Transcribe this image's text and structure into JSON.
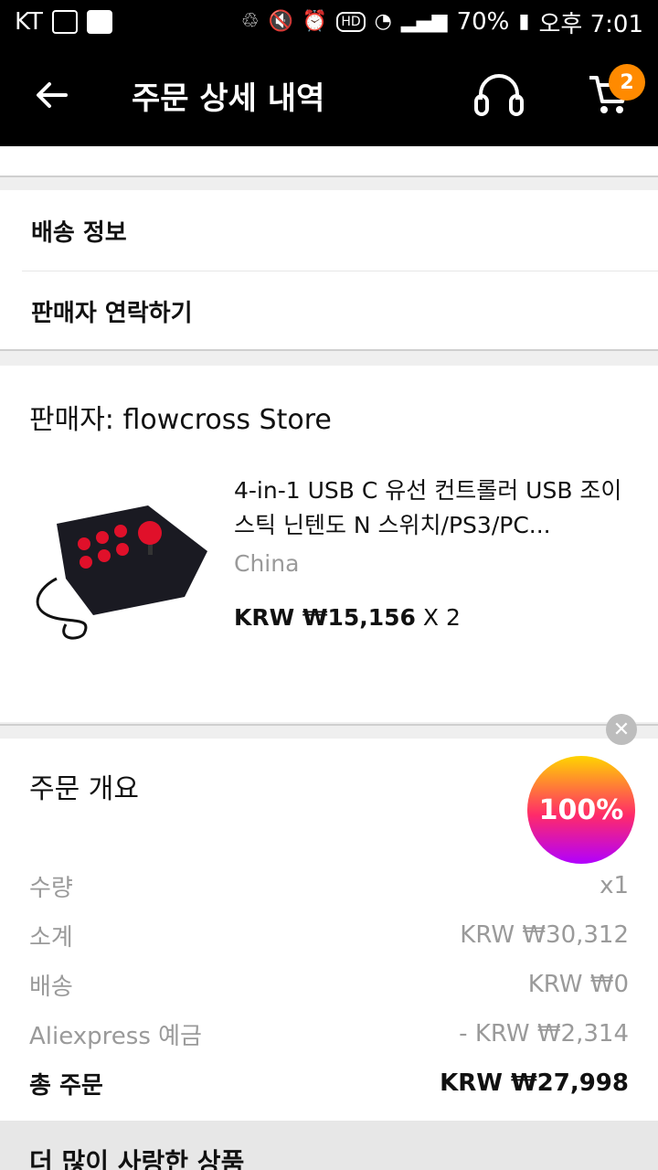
{
  "status_bar": {
    "carrier": "KT",
    "battery": "70%",
    "time": "오후 7:01"
  },
  "app_bar": {
    "title": "주문 상세 내역",
    "cart_count": "2"
  },
  "info_rows": [
    {
      "label": "배송 정보"
    },
    {
      "label": "판매자 연락하기"
    }
  ],
  "order": {
    "seller": "판매자: flowcross Store",
    "product_name": "4-in-1 USB C 유선 컨트롤러 USB 조이스틱 닌텐도 N 스위치/PS3/PC...",
    "origin": "China",
    "price": "KRW ₩15,156",
    "quantity": "X 2"
  },
  "summary": {
    "title": "주문 개요",
    "rows": [
      {
        "label": "수량",
        "value": "x1"
      },
      {
        "label": "소계",
        "value": "KRW ₩30,312"
      },
      {
        "label": "배송",
        "value": "KRW ₩0"
      },
      {
        "label": "Aliexpress 예금",
        "value": "- KRW ₩2,314"
      }
    ],
    "total_label": "총 주문",
    "total_value": "KRW ₩27,998"
  },
  "promo_bubble": {
    "text": "100%"
  },
  "more_section": {
    "title": "더 많이 사랑한 상품"
  },
  "colors": {
    "bar": "#000000",
    "badge": "#ff8a00",
    "joystick_ball": "#e0102a"
  }
}
